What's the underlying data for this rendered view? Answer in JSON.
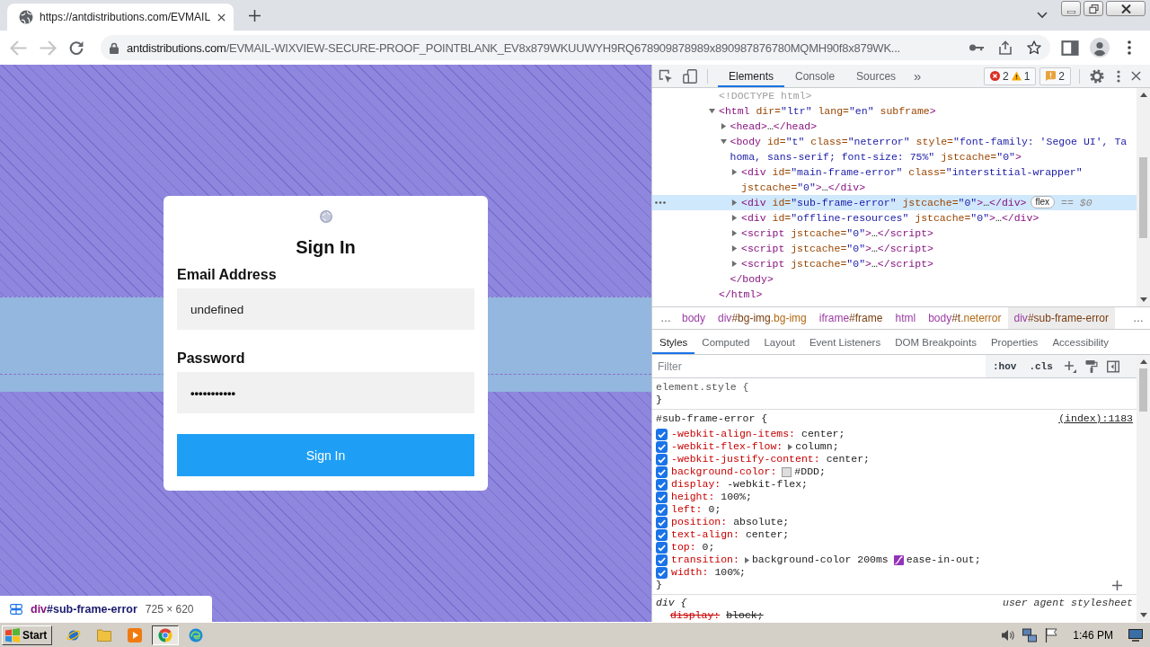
{
  "browser": {
    "tabs": [
      {
        "title": "https://antdistributions.com/EVMAIL",
        "selected": true
      }
    ],
    "back": {
      "disabled": true
    },
    "forward": {
      "disabled": true
    },
    "address": {
      "host": "antdistributions.com",
      "path": "/EVMAIL-WIXVIEW-SECURE-PROOF_POINTBLANK_EV8x879WKUUWYH9RQ678909878989x890987876780MQMH90f8x879WK..."
    }
  },
  "page": {
    "card": {
      "title": "Sign In",
      "fields": [
        {
          "kind": "text",
          "label": "Email Address",
          "value": "undefined"
        },
        {
          "kind": "password",
          "label": "Password",
          "value": "•••••••••••"
        }
      ],
      "button": "Sign In"
    },
    "inspect_tooltip": {
      "tag": "div",
      "id": "#sub-frame-error",
      "size": "725 × 620"
    }
  },
  "devtools": {
    "tabs": [
      {
        "label": "Elements",
        "selected": true
      },
      {
        "label": "Console",
        "selected": false
      },
      {
        "label": "Sources",
        "selected": false
      }
    ],
    "more_tabs": "»",
    "errors": "2",
    "warnings": "1",
    "issues": "2",
    "dom": [
      {
        "kind": "doctype",
        "selected": false,
        "lines": [
          [
            {
              "kind": "doctype",
              "text": "<!DOCTYPE html>"
            }
          ]
        ]
      },
      {
        "kind": "element",
        "expanded": true,
        "selected": false,
        "lines": [
          [
            {
              "kind": "tag",
              "text": "<html"
            },
            {
              "kind": "attr",
              "text": " dir="
            },
            {
              "kind": "value",
              "text": "\"ltr\""
            },
            {
              "kind": "attr",
              "text": " lang="
            },
            {
              "kind": "value",
              "text": "\"en\""
            },
            {
              "kind": "attr",
              "text": " subframe"
            },
            {
              "kind": "tag",
              "text": ">"
            }
          ]
        ],
        "children": [
          {
            "kind": "element",
            "expanded": false,
            "selected": false,
            "lines": [
              [
                {
                  "kind": "tag",
                  "text": "<head>"
                },
                {
                  "kind": "text",
                  "text": "…"
                },
                {
                  "kind": "tag",
                  "text": "</head>"
                }
              ]
            ]
          },
          {
            "kind": "element",
            "expanded": true,
            "selected": false,
            "lines": [
              [
                {
                  "kind": "tag",
                  "text": "<body"
                },
                {
                  "kind": "attr",
                  "text": " id="
                },
                {
                  "kind": "value",
                  "text": "\"t\""
                },
                {
                  "kind": "attr",
                  "text": " class="
                },
                {
                  "kind": "value",
                  "text": "\"neterror\""
                },
                {
                  "kind": "attr",
                  "text": " style="
                },
                {
                  "kind": "value",
                  "text": "\"font-family: 'Segoe UI', Ta"
                }
              ],
              [
                {
                  "kind": "value",
                  "text": "homa, sans-serif; font-size: 75%\""
                },
                {
                  "kind": "attr",
                  "text": " jstcache="
                },
                {
                  "kind": "value",
                  "text": "\"0\""
                },
                {
                  "kind": "tag",
                  "text": ">"
                }
              ]
            ],
            "children": [
              {
                "kind": "element",
                "expanded": false,
                "selected": false,
                "lines": [
                  [
                    {
                      "kind": "tag",
                      "text": "<div"
                    },
                    {
                      "kind": "attr",
                      "text": " id="
                    },
                    {
                      "kind": "value",
                      "text": "\"main-frame-error\""
                    },
                    {
                      "kind": "attr",
                      "text": " class="
                    },
                    {
                      "kind": "value",
                      "text": "\"interstitial-wrapper\""
                    }
                  ],
                  [
                    {
                      "kind": "attr",
                      "text": "jstcache="
                    },
                    {
                      "kind": "value",
                      "text": "\"0\""
                    },
                    {
                      "kind": "tag",
                      "text": ">"
                    },
                    {
                      "kind": "text",
                      "text": "…"
                    },
                    {
                      "kind": "tag",
                      "text": "</div>"
                    }
                  ]
                ]
              },
              {
                "kind": "element",
                "expanded": false,
                "selected": true,
                "lines": [
                  [
                    {
                      "kind": "tag",
                      "text": "<div"
                    },
                    {
                      "kind": "attr",
                      "text": " id="
                    },
                    {
                      "kind": "value",
                      "text": "\"sub-frame-error\""
                    },
                    {
                      "kind": "attr",
                      "text": " jstcache="
                    },
                    {
                      "kind": "value",
                      "text": "\"0\""
                    },
                    {
                      "kind": "tag",
                      "text": ">"
                    },
                    {
                      "kind": "text",
                      "text": "…"
                    },
                    {
                      "kind": "tag",
                      "text": "</div>"
                    }
                  ]
                ],
                "badge": "flex",
                "suffix": "== $0"
              },
              {
                "kind": "element",
                "expanded": false,
                "selected": false,
                "lines": [
                  [
                    {
                      "kind": "tag",
                      "text": "<div"
                    },
                    {
                      "kind": "attr",
                      "text": " id="
                    },
                    {
                      "kind": "value",
                      "text": "\"offline-resources\""
                    },
                    {
                      "kind": "attr",
                      "text": " jstcache="
                    },
                    {
                      "kind": "value",
                      "text": "\"0\""
                    },
                    {
                      "kind": "tag",
                      "text": ">"
                    },
                    {
                      "kind": "text",
                      "text": "…"
                    },
                    {
                      "kind": "tag",
                      "text": "</div>"
                    }
                  ]
                ]
              },
              {
                "kind": "element",
                "expanded": false,
                "selected": false,
                "lines": [
                  [
                    {
                      "kind": "tag",
                      "text": "<script"
                    },
                    {
                      "kind": "attr",
                      "text": " jstcache="
                    },
                    {
                      "kind": "value",
                      "text": "\"0\""
                    },
                    {
                      "kind": "tag",
                      "text": ">"
                    },
                    {
                      "kind": "text",
                      "text": "…"
                    },
                    {
                      "kind": "tag",
                      "text": "</script>"
                    }
                  ]
                ]
              },
              {
                "kind": "element",
                "expanded": false,
                "selected": false,
                "lines": [
                  [
                    {
                      "kind": "tag",
                      "text": "<script"
                    },
                    {
                      "kind": "attr",
                      "text": " jstcache="
                    },
                    {
                      "kind": "value",
                      "text": "\"0\""
                    },
                    {
                      "kind": "tag",
                      "text": ">"
                    },
                    {
                      "kind": "text",
                      "text": "…"
                    },
                    {
                      "kind": "tag",
                      "text": "</script>"
                    }
                  ]
                ]
              },
              {
                "kind": "element",
                "expanded": false,
                "selected": false,
                "lines": [
                  [
                    {
                      "kind": "tag",
                      "text": "<script"
                    },
                    {
                      "kind": "attr",
                      "text": " jstcache="
                    },
                    {
                      "kind": "value",
                      "text": "\"0\""
                    },
                    {
                      "kind": "tag",
                      "text": ">"
                    },
                    {
                      "kind": "text",
                      "text": "…"
                    },
                    {
                      "kind": "tag",
                      "text": "</script>"
                    }
                  ]
                ]
              }
            ],
            "closing": [
              {
                "kind": "tag",
                "text": "</body>"
              }
            ]
          }
        ],
        "closing": [
          {
            "kind": "tag",
            "text": "</html>"
          }
        ]
      }
    ],
    "breadcrumb_overflow": "…",
    "breadcrumbs": [
      {
        "tag": "body",
        "selected": false
      },
      {
        "tag": "div",
        "id": "#bg-img",
        "class": ".bg-img",
        "selected": false
      },
      {
        "tag": "iframe",
        "id": "#frame",
        "selected": false
      },
      {
        "tag": "html",
        "selected": false
      },
      {
        "tag": "body",
        "id": "#t",
        "class": ".neterror",
        "selected": false
      },
      {
        "tag": "div",
        "id": "#sub-frame-error",
        "selected": true
      }
    ],
    "sidebar_tabs": [
      {
        "label": "Styles",
        "selected": true
      },
      {
        "label": "Computed",
        "selected": false
      },
      {
        "label": "Layout",
        "selected": false
      },
      {
        "label": "Event Listeners",
        "selected": false
      },
      {
        "label": "DOM Breakpoints",
        "selected": false
      },
      {
        "label": "Properties",
        "selected": false
      },
      {
        "label": "Accessibility",
        "selected": false
      }
    ],
    "filter": {
      "placeholder": "Filter"
    },
    "filter_toggles": [
      ":hov",
      ".cls"
    ],
    "rules": [
      {
        "kind": "inline",
        "selector": "element.style {",
        "closing": "}"
      },
      {
        "kind": "author",
        "selector": "#sub-frame-error {",
        "source": "(index):1183",
        "closing": "}",
        "properties": [
          {
            "kind": "plain",
            "name": "-webkit-align-items:",
            "value": "center;",
            "checked": true,
            "overridden": false
          },
          {
            "kind": "shorthand",
            "name": "-webkit-flex-flow:",
            "value": "column;",
            "checked": true,
            "overridden": false
          },
          {
            "kind": "plain",
            "name": "-webkit-justify-content:",
            "value": "center;",
            "checked": true,
            "overridden": false
          },
          {
            "kind": "color",
            "name": "background-color:",
            "color": "#dddddd",
            "value": "#DDD;",
            "checked": true,
            "overridden": false
          },
          {
            "kind": "plain",
            "name": "display:",
            "value": "-webkit-flex;",
            "checked": true,
            "overridden": false
          },
          {
            "kind": "plain",
            "name": "height:",
            "value": "100%;",
            "checked": true,
            "overridden": false
          },
          {
            "kind": "plain",
            "name": "left:",
            "value": "0;",
            "checked": true,
            "overridden": false
          },
          {
            "kind": "plain",
            "name": "position:",
            "value": "absolute;",
            "checked": true,
            "overridden": false
          },
          {
            "kind": "plain",
            "name": "text-align:",
            "value": "center;",
            "checked": true,
            "overridden": false
          },
          {
            "kind": "plain",
            "name": "top:",
            "value": "0;",
            "checked": true,
            "overridden": false
          },
          {
            "kind": "transition",
            "name": "transition:",
            "value": "background-color 200ms",
            "easing": "ease-in-out;",
            "checked": true,
            "overridden": false
          },
          {
            "kind": "plain",
            "name": "width:",
            "value": "100%;",
            "checked": true,
            "overridden": false
          }
        ]
      },
      {
        "kind": "user-agent",
        "selector": "div {",
        "source": "user agent stylesheet",
        "properties": [
          {
            "kind": "plain",
            "name": "display:",
            "value": "block;",
            "overridden": true
          }
        ]
      }
    ]
  },
  "taskbar": {
    "start": "Start",
    "apps": [
      {
        "selected": false
      },
      {
        "selected": false
      },
      {
        "selected": false
      },
      {
        "selected": true
      },
      {
        "selected": false
      }
    ],
    "clock": "1:46 PM"
  }
}
